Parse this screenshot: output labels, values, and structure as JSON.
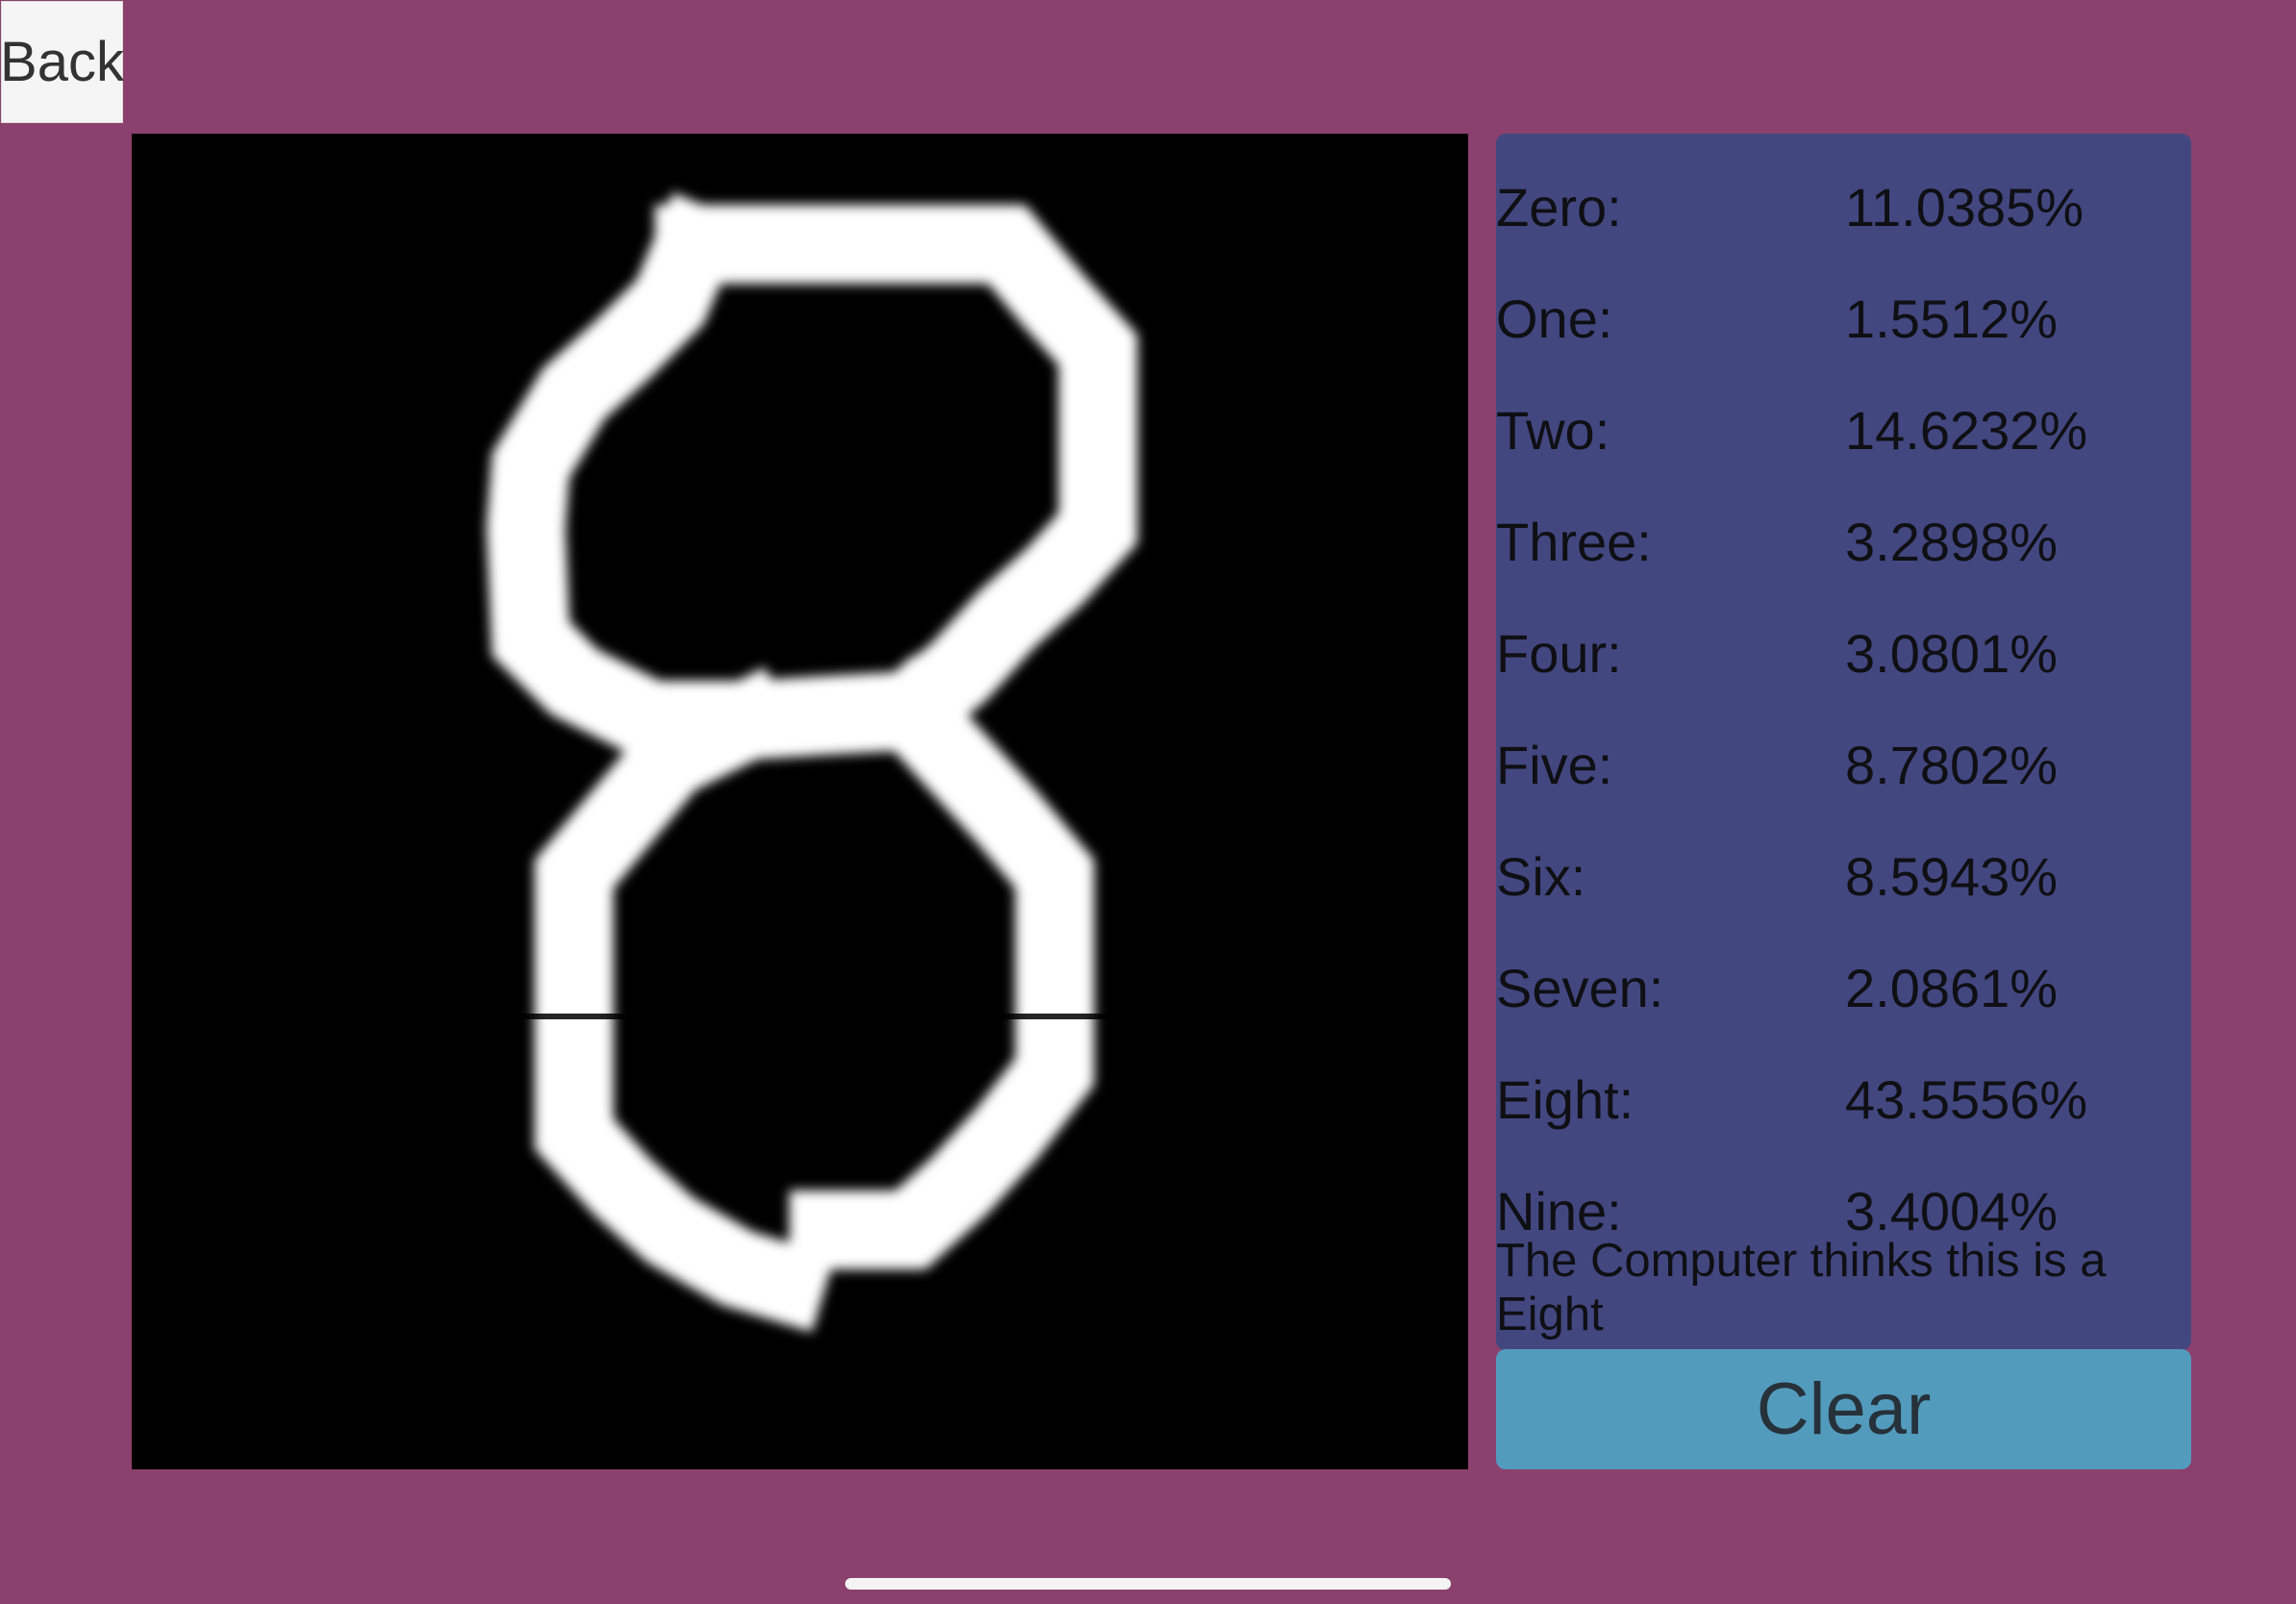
{
  "nav": {
    "back_label": "Back"
  },
  "canvas": {
    "digit_drawn": "8",
    "background": "#000000",
    "stroke_color": "#ffffff"
  },
  "results": [
    {
      "label": "Zero:",
      "value": "11.0385%"
    },
    {
      "label": "One:",
      "value": "1.5512%"
    },
    {
      "label": "Two:",
      "value": "14.6232%"
    },
    {
      "label": "Three:",
      "value": "3.2898%"
    },
    {
      "label": "Four:",
      "value": "3.0801%"
    },
    {
      "label": "Five:",
      "value": "8.7802%"
    },
    {
      "label": "Six:",
      "value": "8.5943%"
    },
    {
      "label": "Seven:",
      "value": "2.0861%"
    },
    {
      "label": "Eight:",
      "value": "43.5556%"
    },
    {
      "label": "Nine:",
      "value": "3.4004%"
    }
  ],
  "prediction_text": "The Computer thinks this is a Eight",
  "clear_label": "Clear",
  "colors": {
    "background": "#8b416d",
    "panel": "#434780",
    "clear_button": "#529bbd",
    "back_button": "#f5f5f5"
  }
}
